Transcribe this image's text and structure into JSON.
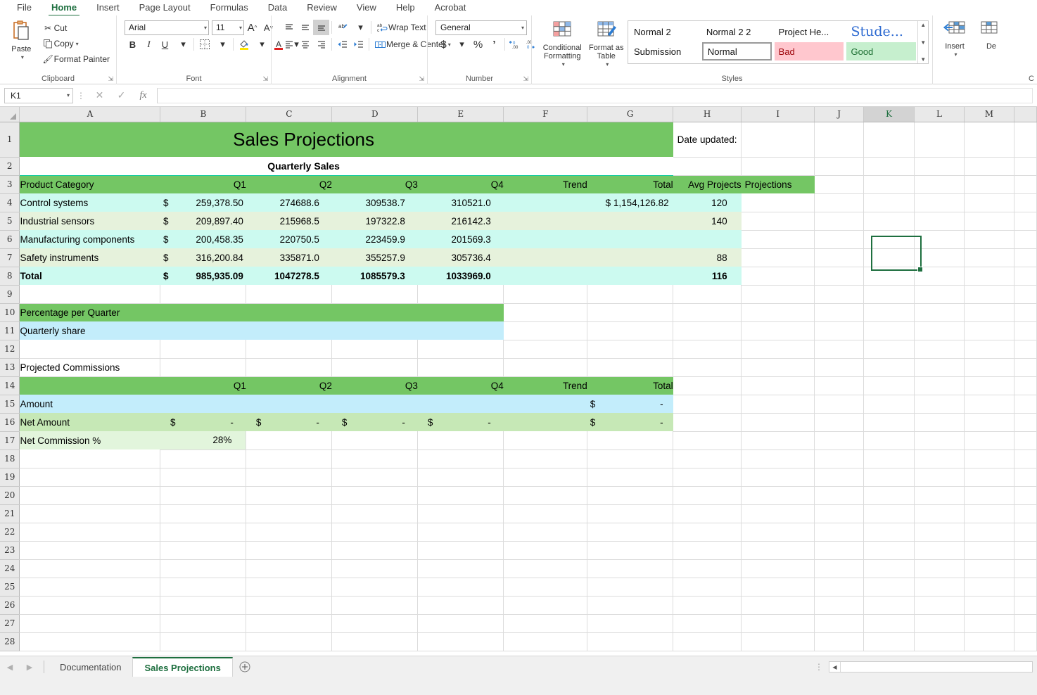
{
  "ribbon": {
    "tabs": [
      {
        "label": "File"
      },
      {
        "label": "Home"
      },
      {
        "label": "Insert"
      },
      {
        "label": "Page Layout"
      },
      {
        "label": "Formulas"
      },
      {
        "label": "Data"
      },
      {
        "label": "Review"
      },
      {
        "label": "View"
      },
      {
        "label": "Help"
      },
      {
        "label": "Acrobat"
      }
    ],
    "clipboard": {
      "group_label": "Clipboard",
      "paste": "Paste",
      "cut": "Cut",
      "copy": "Copy",
      "format_painter": "Format Painter"
    },
    "font": {
      "group_label": "Font",
      "font_name": "Arial",
      "font_size": "11",
      "bold": "B",
      "italic": "I",
      "underline": "U"
    },
    "alignment": {
      "group_label": "Alignment",
      "wrap_text": "Wrap Text",
      "merge_center": "Merge & Center"
    },
    "number": {
      "group_label": "Number",
      "format": "General",
      "currency": "$",
      "percent": "%",
      "comma": "‰"
    },
    "styles": {
      "group_label": "Styles",
      "conditional_formatting": "Conditional Formatting",
      "format_as_table": "Format as Table",
      "gallery": [
        "Normal 2",
        "Submission",
        "Normal 2 2",
        "Normal",
        "Project He...",
        "Bad",
        "Stude...",
        "Good"
      ],
      "colors": {
        "bad_bg": "#ffc7ce",
        "bad_fg": "#9c0006",
        "good_bg": "#c6efce",
        "good_fg": "#1c6e32"
      }
    },
    "cells": {
      "group_label": "C",
      "insert": "Insert",
      "delete": "De"
    }
  },
  "formula_bar": {
    "name_box": "K1",
    "formula": ""
  },
  "grid": {
    "columns": [
      "A",
      "B",
      "C",
      "D",
      "E",
      "F",
      "G",
      "H",
      "I",
      "J",
      "K",
      "L",
      "M"
    ],
    "active_column": "K",
    "active_cell": "K1",
    "rows": [
      "1",
      "2",
      "3",
      "4",
      "5",
      "6",
      "7",
      "8",
      "9",
      "10",
      "11",
      "12",
      "13",
      "14",
      "15",
      "16",
      "17",
      "18",
      "19",
      "20",
      "21",
      "22",
      "23",
      "24",
      "25",
      "26",
      "27",
      "28"
    ]
  },
  "sheet": {
    "title": "Sales Projections",
    "subtitle": "Quarterly Sales",
    "date_updated_label": "Date updated:",
    "table1": {
      "headers": [
        "Product Category",
        "Q1",
        "Q2",
        "Q3",
        "Q4",
        "Trend",
        "Total",
        "Avg Projects",
        "Projections"
      ],
      "rows": [
        {
          "category": "Control systems",
          "q1_sym": "$",
          "q1": "259,378.50",
          "q2": "274688.6",
          "q3": "309538.7",
          "q4": "310521.0",
          "trend": "",
          "total": "$ 1,154,126.82",
          "avg": "120",
          "proj": ""
        },
        {
          "category": "Industrial sensors",
          "q1_sym": "$",
          "q1": "209,897.40",
          "q2": "215968.5",
          "q3": "197322.8",
          "q4": "216142.3",
          "trend": "",
          "total": "",
          "avg": "140",
          "proj": ""
        },
        {
          "category": "Manufacturing components",
          "q1_sym": "$",
          "q1": "200,458.35",
          "q2": "220750.5",
          "q3": "223459.9",
          "q4": "201569.3",
          "trend": "",
          "total": "",
          "avg": "",
          "proj": ""
        },
        {
          "category": "Safety instruments",
          "q1_sym": "$",
          "q1": "316,200.84",
          "q2": "335871.0",
          "q3": "355257.9",
          "q4": "305736.4",
          "trend": "",
          "total": "",
          "avg": "88",
          "proj": ""
        }
      ],
      "total_row": {
        "category": "Total",
        "q1_sym": "$",
        "q1": "985,935.09",
        "q2": "1047278.5",
        "q3": "1085579.3",
        "q4": "1033969.0",
        "trend": "",
        "total": "",
        "avg": "116",
        "proj": ""
      }
    },
    "section2": {
      "header": "Percentage per Quarter",
      "row_label": "Quarterly share"
    },
    "section3": {
      "header": "Projected Commissions",
      "col_headers": [
        "Q1",
        "Q2",
        "Q3",
        "Q4",
        "Trend",
        "Total"
      ],
      "amount": {
        "label": "Amount",
        "q1": "",
        "q2": "",
        "q3": "",
        "q4": "",
        "trend": "",
        "total_sym": "$",
        "total": "-"
      },
      "net_amount": {
        "label": "Net Amount",
        "sym": "$",
        "dash": "-",
        "total_sym": "$",
        "total": "-"
      },
      "net_commission": {
        "label": "Net Commission %",
        "value": "28%"
      }
    }
  },
  "sheet_tabs": {
    "tabs": [
      {
        "label": "Documentation",
        "active": false
      },
      {
        "label": "Sales Projections",
        "active": true
      }
    ],
    "add_label": "+"
  }
}
